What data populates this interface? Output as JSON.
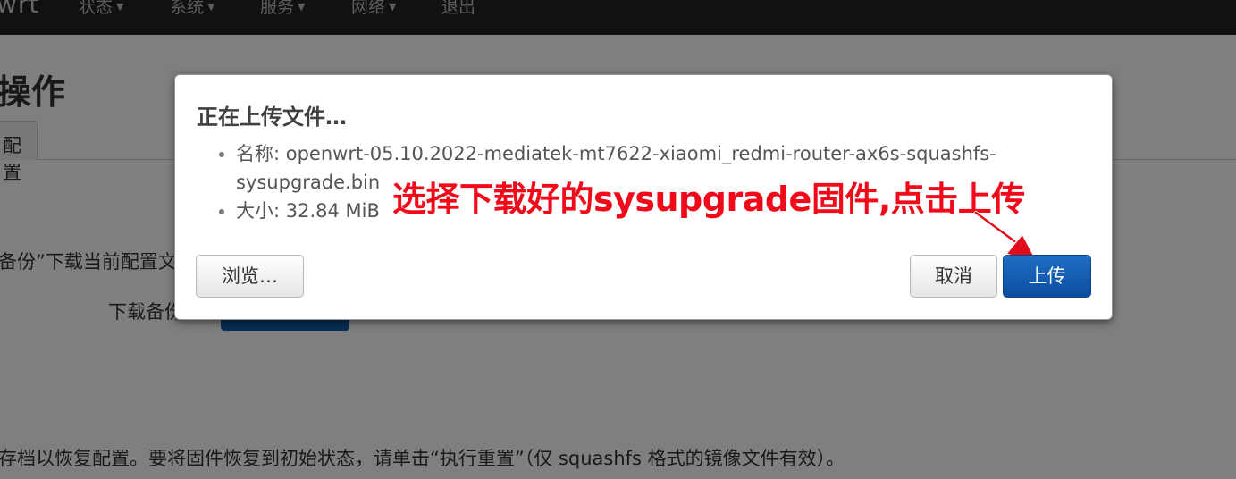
{
  "navbar": {
    "brand": "wrt",
    "items": [
      {
        "label": "状态"
      },
      {
        "label": "系统"
      },
      {
        "label": "服务"
      },
      {
        "label": "网络"
      },
      {
        "label": "退出"
      }
    ]
  },
  "page": {
    "title": "操作",
    "tab_label": "配置",
    "backup_text": "备份”下载当前配置文",
    "download_label": "下载备份",
    "restore_text": "存档以恢复配置。要将固件恢复到初始状态，请单击“执行重置”（仅 squashfs 格式的镜像文件有效）。"
  },
  "modal": {
    "title": "正在上传文件…",
    "file_info": [
      {
        "label": "名称: openwrt-05.10.2022-mediatek-mt7622-xiaomi_redmi-router-ax6s-squashfs-sysupgrade.bin"
      },
      {
        "label": "大小: 32.84 MiB"
      }
    ],
    "annotation": "选择下载好的sysupgrade固件,点击上传",
    "buttons": {
      "browse": "浏览…",
      "cancel": "取消",
      "upload": "上传"
    }
  },
  "colors": {
    "navbar_bg": "#222222",
    "primary": "#0b4da0",
    "annotation_red": "#f00a1a"
  }
}
